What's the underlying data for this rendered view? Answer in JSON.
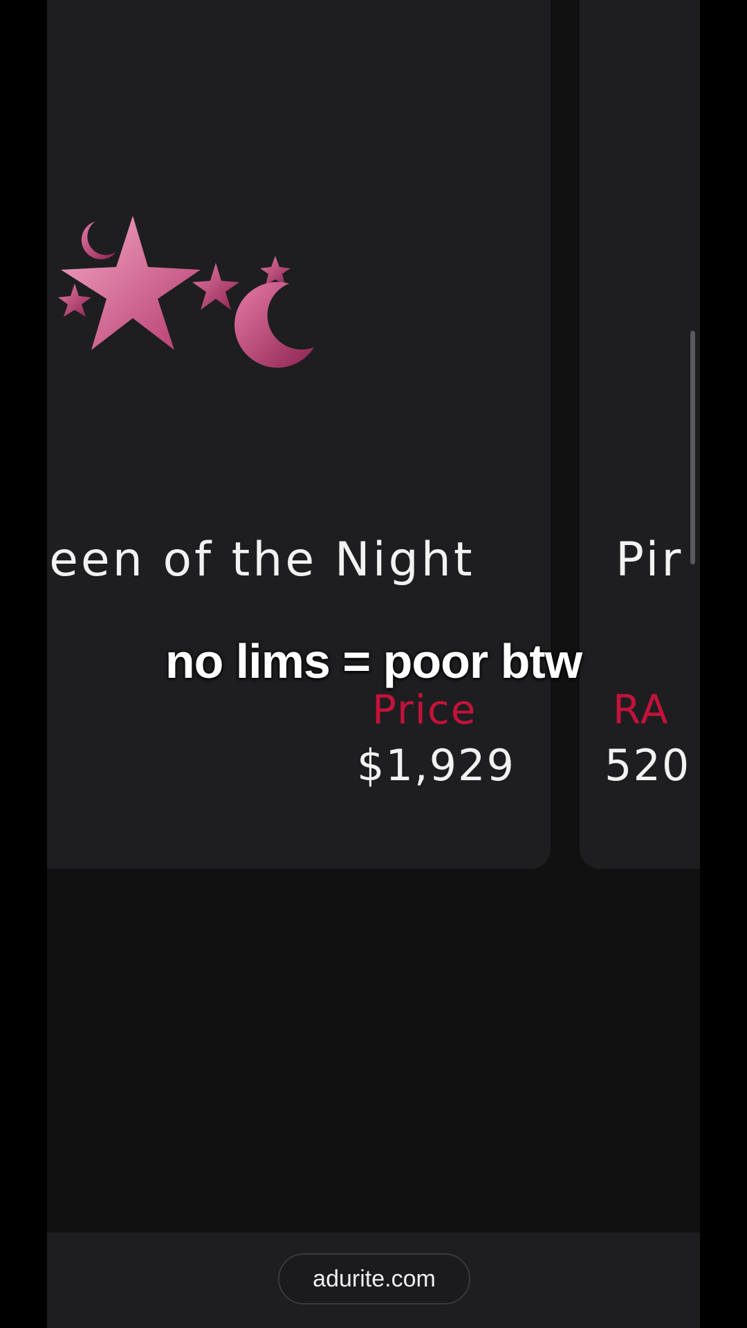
{
  "cards": [
    {
      "title": "ueen of the Night",
      "stat_label": "Price",
      "stat_value": "$1,929",
      "image": "stars-and-moons-hat-icon"
    },
    {
      "title": "Pir",
      "stat_label": "RA",
      "stat_value": "520"
    }
  ],
  "caption": "no lims = poor btw",
  "browser": {
    "url": "adurite.com"
  },
  "colors": {
    "accent": "#c4123a",
    "card_background": "#1e1e21",
    "page_background": "#111112",
    "item_pink": "#e0679a"
  }
}
